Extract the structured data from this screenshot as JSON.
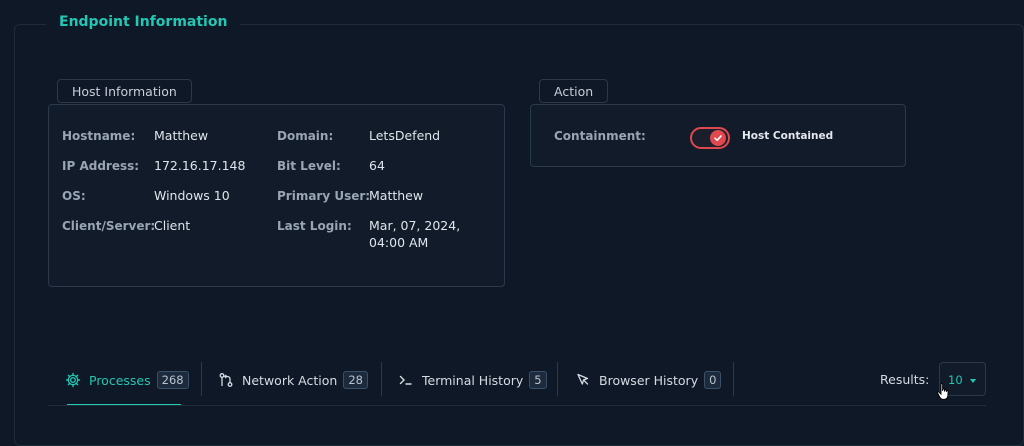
{
  "endpoint": {
    "title": "Endpoint Information"
  },
  "host_info": {
    "tab_label": "Host Information",
    "fields": {
      "hostname": {
        "label": "Hostname:",
        "value": "Matthew"
      },
      "ip": {
        "label": "IP Address:",
        "value": "172.16.17.148"
      },
      "os": {
        "label": "OS:",
        "value": "Windows 10"
      },
      "client": {
        "label": "Client/Server:",
        "value": "Client"
      },
      "domain": {
        "label": "Domain:",
        "value": "LetsDefend"
      },
      "bit": {
        "label": "Bit Level:",
        "value": "64"
      },
      "user": {
        "label": "Primary User:",
        "value": "Matthew"
      },
      "login": {
        "label": "Last Login:",
        "value": "Mar, 07, 2024, 04:00 AM"
      }
    }
  },
  "action": {
    "tab_label": "Action",
    "containment_label": "Containment:",
    "toggle_state": "on",
    "toggle_text": "Host Contained",
    "toggle_color": "#e0484f"
  },
  "tabs": [
    {
      "label": "Processes",
      "count": "268",
      "icon": "gear-icon"
    },
    {
      "label": "Network Action",
      "count": "28",
      "icon": "git-branch-icon"
    },
    {
      "label": "Terminal History",
      "count": "5",
      "icon": "terminal-icon"
    },
    {
      "label": "Browser History",
      "count": "0",
      "icon": "pointer-icon"
    }
  ],
  "results": {
    "label": "Results:",
    "value": "10"
  },
  "colors": {
    "accent": "#23c7b3",
    "background": "#0f1826",
    "border": "#2a394b"
  }
}
